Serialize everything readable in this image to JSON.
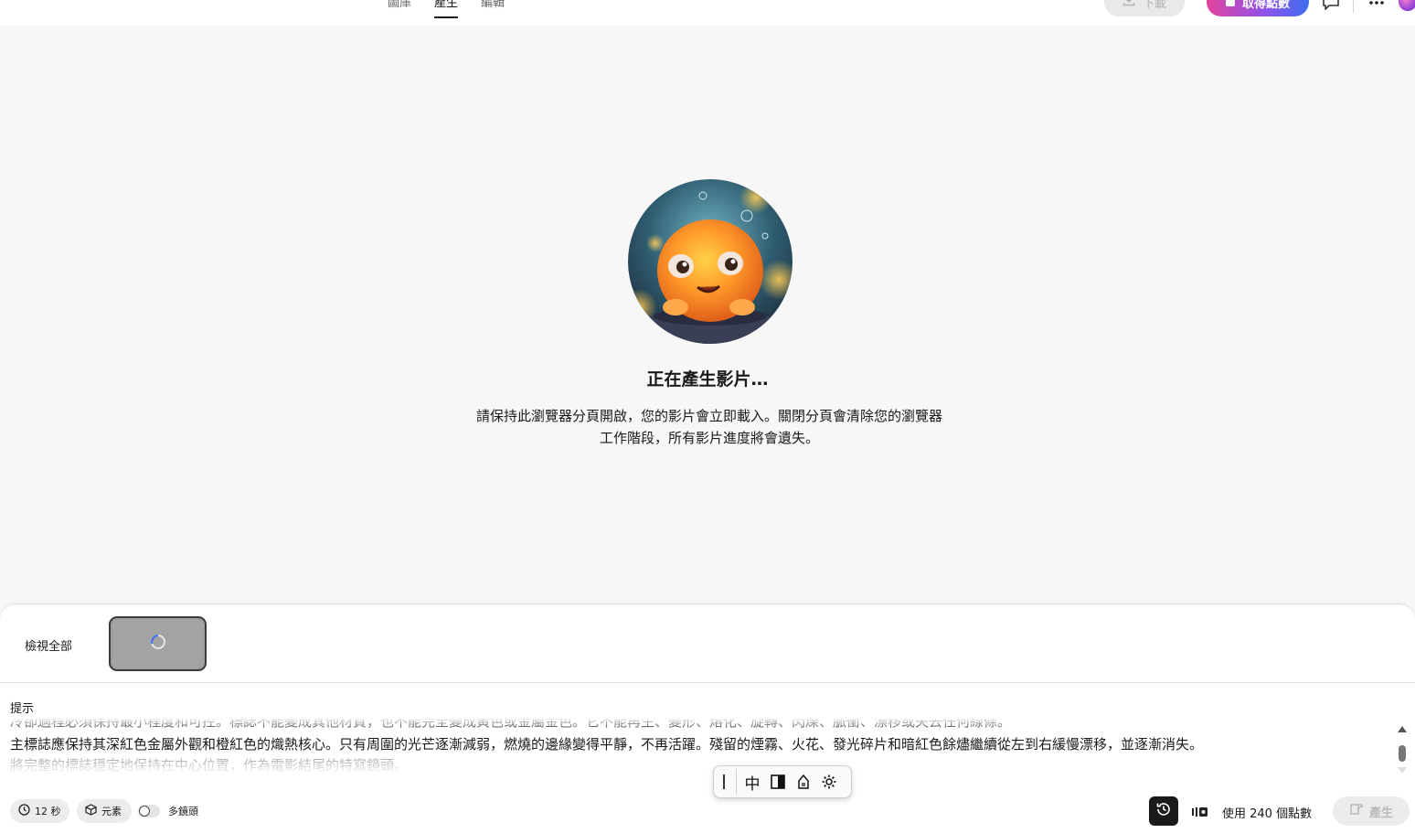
{
  "header": {
    "tabs": [
      {
        "label": "圖庫",
        "active": false
      },
      {
        "label": "產生",
        "active": true
      },
      {
        "label": "編輯",
        "active": false
      }
    ],
    "download_label": "下載",
    "get_points_label": "取得點數",
    "icons": [
      "download-icon",
      "comment-icon",
      "apps-grid-icon",
      "account-avatar"
    ]
  },
  "loading": {
    "title": "正在產生影片…",
    "description_line1": "請保持此瀏覽器分頁開啟，您的影片會立即載入。關閉分頁會清除您的瀏覽器",
    "description_line2": "工作階段，所有影片進度將會遺失。"
  },
  "panel": {
    "view_all_label": "檢視全部",
    "prompt_label": "提示",
    "prompt_lines": [
      "冷卻過程必須保持最小程度和可控。標誌不能變成其他材質，也不能完全變成黃色或金屬金色。它不能再生、變形、熔化、旋轉、閃爍、脈衝、漂移或失去任何線條。",
      "主標誌應保持其深紅色金屬外觀和橙紅色的熾熱核心。只有周圍的光芒逐漸減弱，燃燒的邊緣變得平靜，不再活躍。殘留的煙霧、火花、發光碎片和暗紅色餘燼繼續從左到右緩慢漂移，並逐漸消失。",
      "將完整的標誌穩定地保持在中心位置，作為電影結尾的特寫鏡頭。"
    ],
    "ime": {
      "mode_label": "中"
    },
    "duration_label": "12 秒",
    "elements_label": "元素",
    "multishot_label": "多鏡頭",
    "multishot_on": false,
    "cost_label": "使用 240 個點數",
    "generate_label": "產生"
  },
  "colors": {
    "accent_gradient_start": "#e2439b",
    "accent_gradient_end": "#3f6cf0",
    "page_bg": "#f7f7f7"
  }
}
